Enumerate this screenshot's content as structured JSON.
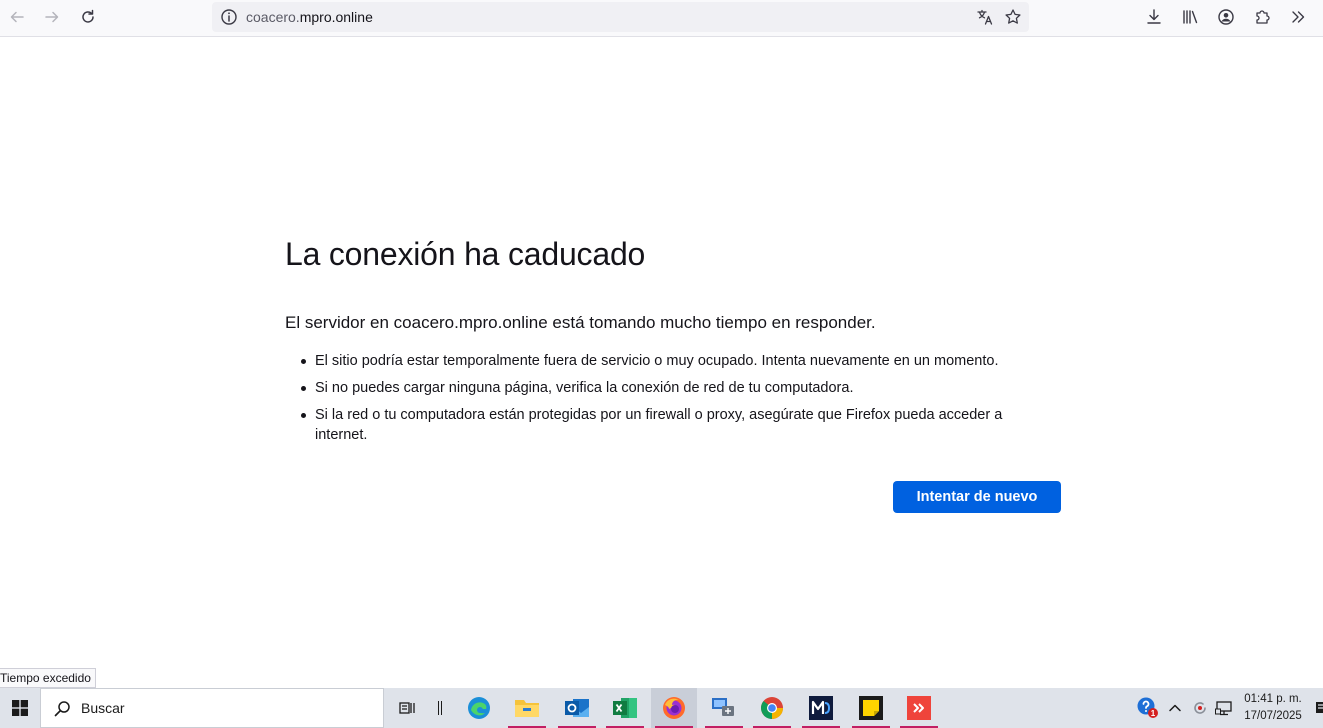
{
  "browser": {
    "url_prefix": "coacero.",
    "url_domain": "mpro.online"
  },
  "error": {
    "title": "La conexión ha caducado",
    "description": "El servidor en coacero.mpro.online está tomando mucho tiempo en responder.",
    "bullets": [
      "El sitio podría estar temporalmente fuera de servicio o muy ocupado. Intenta nuevamente en un momento.",
      "Si no puedes cargar ninguna página, verifica la conexión de red de tu computadora.",
      "Si la red o tu computadora están protegidas por un firewall o proxy, asegúrate que Firefox pueda acceder a internet."
    ],
    "retry_label": "Intentar de nuevo"
  },
  "status_tooltip": "Tiempo excedido",
  "taskbar": {
    "search_label": "Buscar",
    "time": "01:41 p. m.",
    "date": "17/07/2025",
    "help_badge": "1"
  },
  "colors": {
    "accent": "#0061e0",
    "taskbar": "#dfe3ea",
    "running_indicator": "#c21f63"
  }
}
